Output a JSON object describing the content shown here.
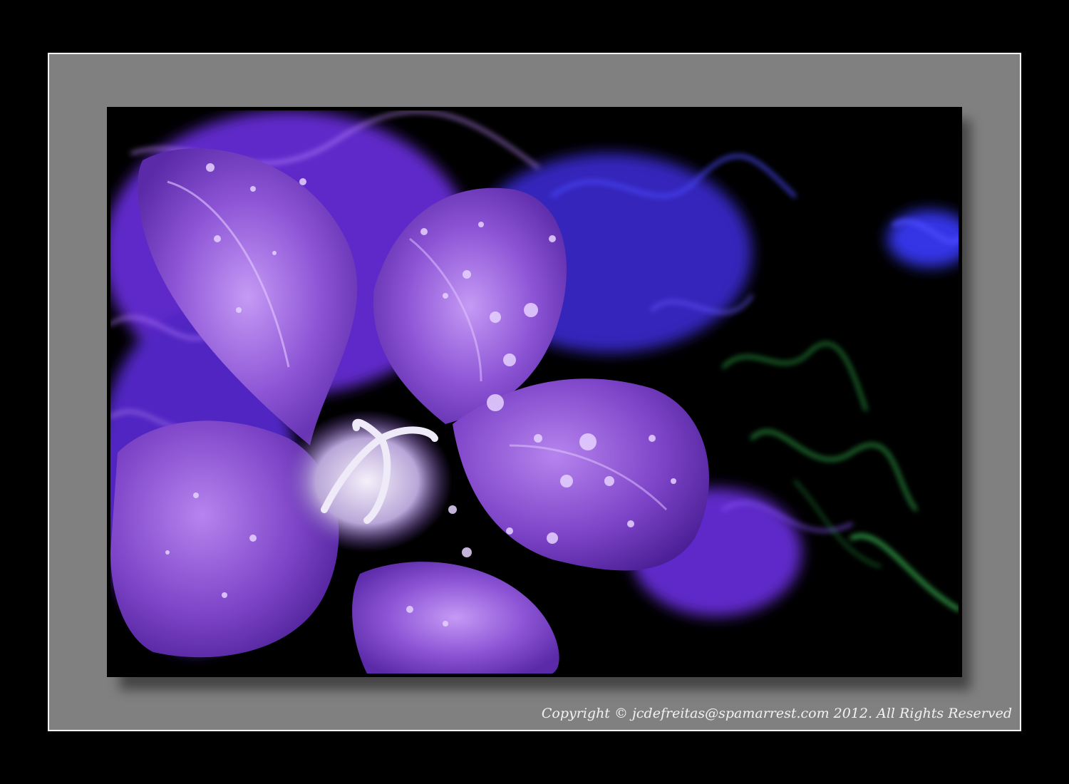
{
  "photo": {
    "subject_icon": "purple-bellflower-with-water-droplets",
    "colors": {
      "background": "#000000",
      "mat": "#808080",
      "mat_border": "#ffffff",
      "petal": "#8a4fd0",
      "petal_light": "#c08cf0",
      "glow_violet": "#7a3cff",
      "glow_blue": "#3b3bff",
      "glow_green": "#2fb84a",
      "pistil": "#e8e4f4"
    }
  },
  "watermark": {
    "text": "Copyright © jcdefreitas@spamarrest.com 2012. All Rights Reserved"
  }
}
